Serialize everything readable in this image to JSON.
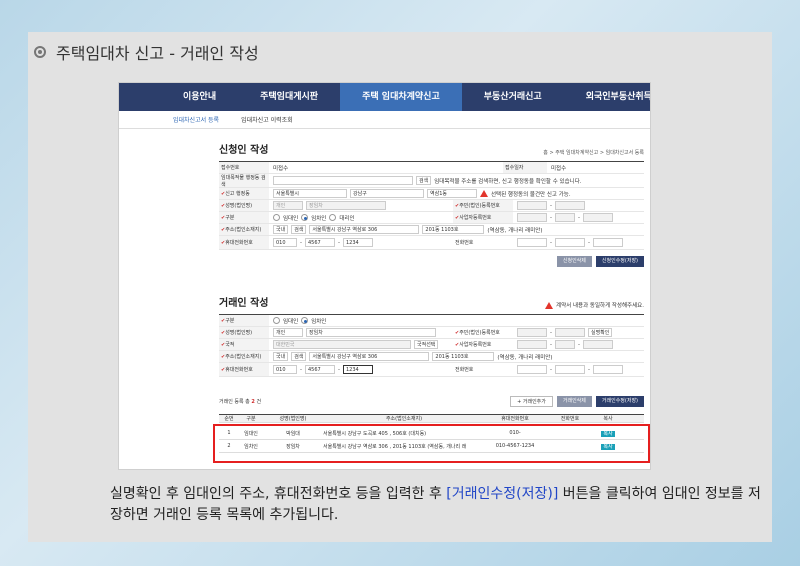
{
  "slide": {
    "title": "주택임대차 신고 - 거래인 작성",
    "caption_pre": "실명확인 후 임대인의 주소, 휴대전화번호 등을 입력한 후 ",
    "caption_hl": "[거래인수정(저장)]",
    "caption_post": " 버튼을 클릭하여 임대인 정보를 저장하면 거래인 등록 목록에 추가됩니다."
  },
  "nav": {
    "items": [
      "이용안내",
      "주택임대게시판",
      "주택 임대차계약신고",
      "부동산거래신고",
      "외국인부동산취득"
    ],
    "active_index": 2
  },
  "subnav": {
    "items": [
      "임대차신고서 등록",
      "임대차신고 이력조회"
    ]
  },
  "applicant": {
    "title": "신청인 작성",
    "breadcrumb": "홈 > 주택 임대차계약신고 > 임대차신고서 등록",
    "receipt_no_label": "접수번호",
    "receipt_no": "미접수",
    "receipt_date_label": "접수일자",
    "receipt_date": "미접수",
    "addr_search_label": "임대목적물 행정동 검색",
    "addr_search_btn": "검색",
    "addr_hint": "임대목적물 주소를 검색하면, 신고 행정동을 확인할 수 있습니다.",
    "office_label": "신고 행정동",
    "office_city": "서울특별시",
    "office_gu": "강남구",
    "office_dong": "역삼1동",
    "office_warn": "선택된 행정동의 물건만 신고 가능.",
    "name_label": "성명(법인명)",
    "name_type": "개인",
    "name": "장임차",
    "idno_label": "주민(법인)등록번호",
    "type_label": "구분",
    "type_options": [
      "임대인",
      "임차인",
      "대리인"
    ],
    "bizno_label": "사업자등록번호",
    "addr_label": "주소(법인소재지)",
    "addr_country": "국내",
    "addr_btn": "검색",
    "addr": "서울특별시 강남구 역삼로 306",
    "addr_detail": "201동 1103호",
    "addr_extra": "(역삼동, 개나리 래미안)",
    "phone_label": "휴대전화번호",
    "phone1": "010",
    "phone2": "4567",
    "phone3": "1234",
    "tel_label": "전화번호",
    "btn_delete": "신청인삭제",
    "btn_save": "신청인수정(저장)"
  },
  "party": {
    "title": "거래인 작성",
    "warn": "계약서 내용과 동일하게 작성해주세요.",
    "type_label": "구분",
    "type_options": [
      "임대인",
      "임차인"
    ],
    "name_label": "성명(법인명)",
    "name_type": "개인",
    "name": "장임차",
    "idno_label": "주민(법인)등록번호",
    "verify_btn": "실명확인",
    "nation_label": "국적",
    "nation": "대한민국",
    "nation_btn": "국적선택",
    "bizno_label": "사업자등록번호",
    "addr_label": "주소(법인소재지)",
    "addr_country": "국내",
    "addr_btn": "검색",
    "addr": "서울특별시 강남구 역삼로 306",
    "addr_detail": "201동 1103호",
    "addr_extra": "(역삼동, 개나리 래미안)",
    "phone_label": "휴대전화번호",
    "phone1": "010",
    "phone2": "4567",
    "phone3": "1234",
    "tel_label": "전화번호",
    "list_count_pre": "거래인 등록 총",
    "list_count": "2",
    "list_count_post": "건",
    "btn_add": "+ 거래인추가",
    "btn_delete": "거래인삭제",
    "btn_save": "거래인수정(저장)"
  },
  "table": {
    "headers": [
      "순번",
      "구분",
      "성명(법인명)",
      "주소(법인소재지)",
      "휴대전화번호",
      "전화번호",
      "복사"
    ],
    "rows": [
      [
        "1",
        "임대인",
        "박임대",
        "서울특별시 강남구 도곡로 405 , 506호 (대치동)",
        "010-",
        "",
        "복사"
      ],
      [
        "2",
        "임차인",
        "장임차",
        "서울특별시 강남구 역삼로 306 , 201동 1103호 (역삼동, 개나리 래",
        "010-4567-1234",
        "",
        "복사"
      ]
    ]
  }
}
